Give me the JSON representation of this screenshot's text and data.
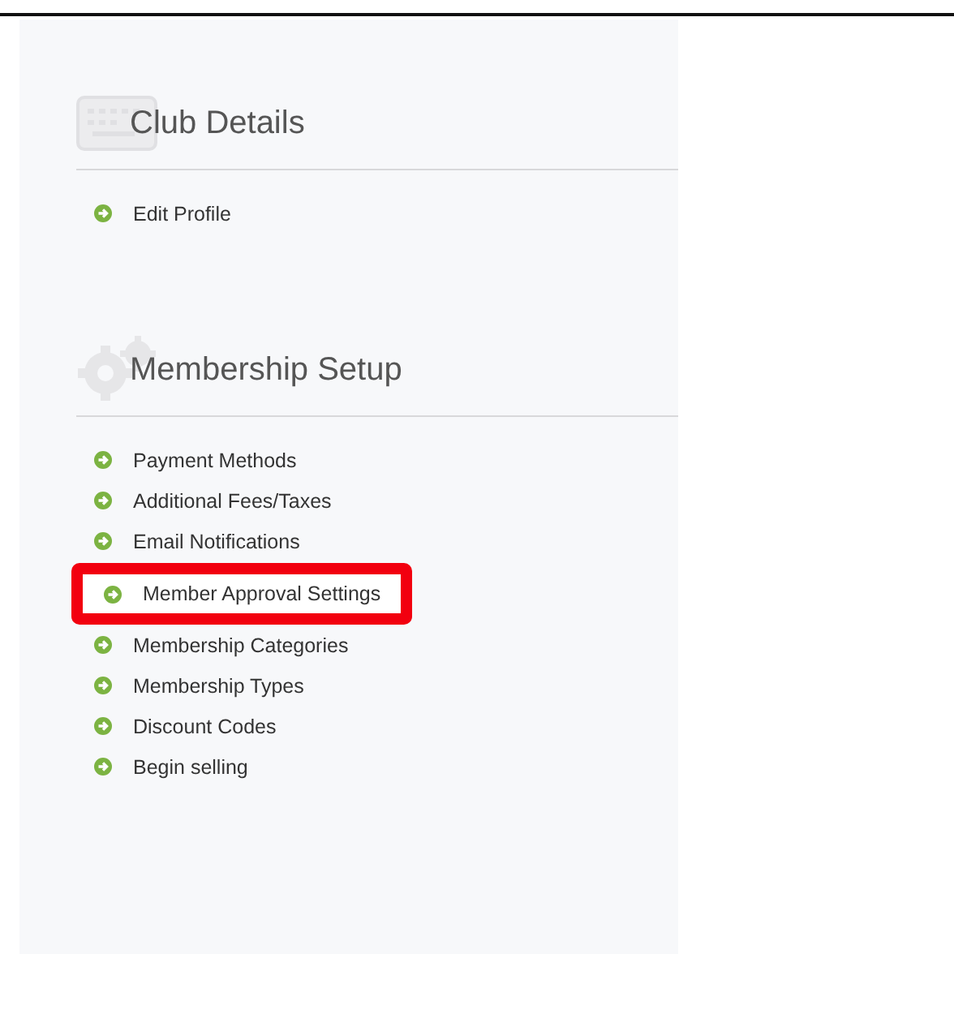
{
  "sections": [
    {
      "title": "Club Details",
      "kind": "club",
      "items": [
        {
          "label": "Edit Profile",
          "highlighted": false
        }
      ]
    },
    {
      "title": "Membership Setup",
      "kind": "membership",
      "items": [
        {
          "label": "Payment Methods",
          "highlighted": false
        },
        {
          "label": "Additional Fees/Taxes",
          "highlighted": false
        },
        {
          "label": "Email Notifications",
          "highlighted": false
        },
        {
          "label": "Member Approval Settings",
          "highlighted": true
        },
        {
          "label": "Membership Categories",
          "highlighted": false
        },
        {
          "label": "Membership Types",
          "highlighted": false
        },
        {
          "label": "Discount Codes",
          "highlighted": false
        },
        {
          "label": "Begin selling",
          "highlighted": false
        }
      ]
    }
  ]
}
